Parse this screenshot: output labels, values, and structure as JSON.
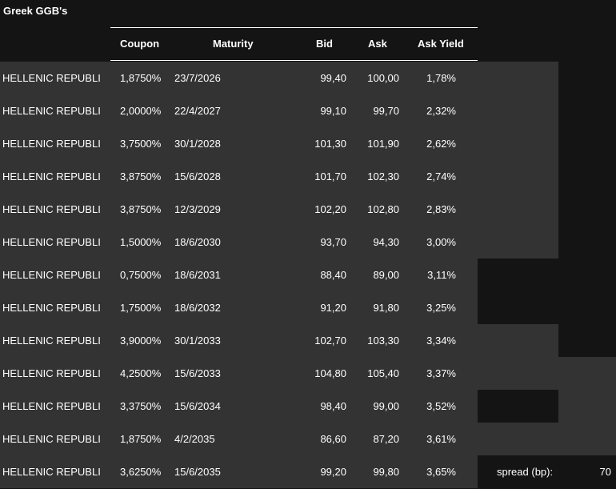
{
  "title": "Greek GGB's",
  "headers": {
    "coupon": "Coupon",
    "maturity": "Maturity",
    "bid": "Bid",
    "ask": "Ask",
    "ask_yield": "Ask Yield"
  },
  "rows": [
    {
      "name": "HELLENIC REPUBLI",
      "coupon": "1,8750%",
      "maturity": "23/7/2026",
      "bid": "99,40",
      "ask": "100,00",
      "ask_yield": "1,78%"
    },
    {
      "name": "HELLENIC REPUBLI",
      "coupon": "2,0000%",
      "maturity": "22/4/2027",
      "bid": "99,10",
      "ask": "99,70",
      "ask_yield": "2,32%"
    },
    {
      "name": "HELLENIC REPUBLI",
      "coupon": "3,7500%",
      "maturity": "30/1/2028",
      "bid": "101,30",
      "ask": "101,90",
      "ask_yield": "2,62%"
    },
    {
      "name": "HELLENIC REPUBLI",
      "coupon": "3,8750%",
      "maturity": "15/6/2028",
      "bid": "101,70",
      "ask": "102,30",
      "ask_yield": "2,74%"
    },
    {
      "name": "HELLENIC REPUBLI",
      "coupon": "3,8750%",
      "maturity": "12/3/2029",
      "bid": "102,20",
      "ask": "102,80",
      "ask_yield": "2,83%"
    },
    {
      "name": "HELLENIC REPUBLI",
      "coupon": "1,5000%",
      "maturity": "18/6/2030",
      "bid": "93,70",
      "ask": "94,30",
      "ask_yield": "3,00%"
    },
    {
      "name": "HELLENIC REPUBLI",
      "coupon": "0,7500%",
      "maturity": "18/6/2031",
      "bid": "88,40",
      "ask": "89,00",
      "ask_yield": "3,11%"
    },
    {
      "name": "HELLENIC REPUBLI",
      "coupon": "1,7500%",
      "maturity": "18/6/2032",
      "bid": "91,20",
      "ask": "91,80",
      "ask_yield": "3,25%"
    },
    {
      "name": "HELLENIC REPUBLI",
      "coupon": "3,9000%",
      "maturity": "30/1/2033",
      "bid": "102,70",
      "ask": "103,30",
      "ask_yield": "3,34%"
    },
    {
      "name": "HELLENIC REPUBLI",
      "coupon": "4,2500%",
      "maturity": "15/6/2033",
      "bid": "104,80",
      "ask": "105,40",
      "ask_yield": "3,37%"
    },
    {
      "name": "HELLENIC REPUBLI",
      "coupon": "3,3750%",
      "maturity": "15/6/2034",
      "bid": "98,40",
      "ask": "99,00",
      "ask_yield": "3,52%"
    },
    {
      "name": "HELLENIC REPUBLI",
      "coupon": "1,8750%",
      "maturity": "4/2/2035",
      "bid": "86,60",
      "ask": "87,20",
      "ask_yield": "3,61%"
    },
    {
      "name": "HELLENIC REPUBLI",
      "coupon": "3,6250%",
      "maturity": "15/6/2035",
      "bid": "99,20",
      "ask": "99,80",
      "ask_yield": "3,65%"
    }
  ],
  "spread": {
    "label": "spread (bp):",
    "value": "70"
  },
  "colors": {
    "cell_bg": "#333333",
    "dark_bg": "#141414",
    "text": "#ffffff"
  }
}
